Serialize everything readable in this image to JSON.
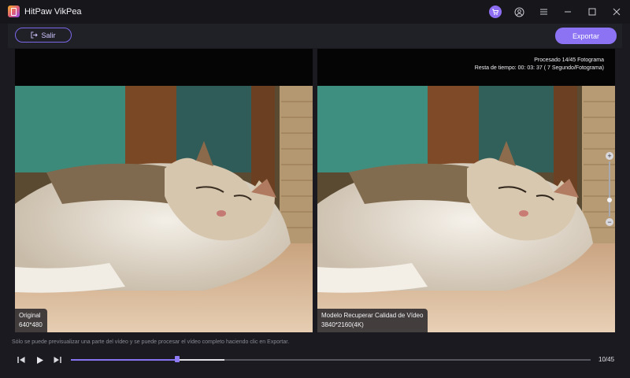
{
  "app": {
    "title": "HitPaw VikPea"
  },
  "titlebar_icons": [
    "cart-icon",
    "user-icon",
    "menu-icon",
    "minimize-icon",
    "maximize-icon",
    "close-icon"
  ],
  "toolbar": {
    "exit_label": "Salir",
    "export_label": "Exportar"
  },
  "preview": {
    "left": {
      "label": "Original",
      "resolution": "640*480"
    },
    "right": {
      "label": "Modelo Recuperar Calidad de Vídeo",
      "resolution": "3840*2160(4K)",
      "processed": "Procesado 14/45 Fotograma",
      "time_left": "Resta de tiempo: 00: 03: 37 ( 7 Segundo/Fotograma)"
    }
  },
  "footer": {
    "note": "Sólo se puede previsualizar una parte del vídeo y se puede procesar el vídeo completo haciendo clic en Exportar.",
    "frame_counter": "10/45",
    "progress_played": 0.205,
    "progress_processed": 0.295
  },
  "colors": {
    "accent": "#8b73f3",
    "background": "#1a1a20"
  }
}
